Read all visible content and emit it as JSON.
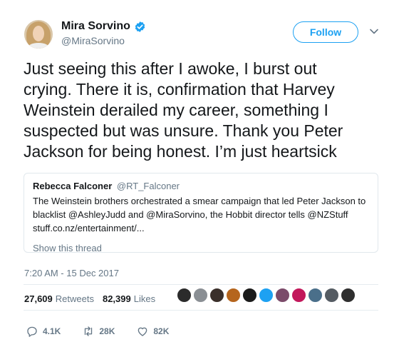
{
  "author": {
    "name": "Mira Sorvino",
    "handle": "@MiraSorvino",
    "verified": true,
    "avatar_icon": "user-avatar"
  },
  "follow_label": "Follow",
  "tweet_text": "Just seeing this after I awoke, I burst out\ncrying. There it is, confirmation that Harvey\nWeinstein derailed my career, something I\nsuspected but was unsure. Thank you Peter\nJackson for being honest. I’m just heartsick",
  "quote": {
    "name": "Rebecca Falconer",
    "handle": "@RT_Falconer",
    "text_line1": "The Weinstein brothers orchestrated a smear campaign that led Peter Jackson to",
    "text_line2": "blacklist @AshleyJudd and @MiraSorvino, the Hobbit director tells @NZStuff",
    "link": "stuff.co.nz/entertainment/...",
    "show_thread": "Show this thread"
  },
  "timestamp": "7:20 AM - 15 Dec 2017",
  "stats": {
    "retweets_count": "27,609",
    "retweets_label": "Retweets",
    "likes_count": "82,399",
    "likes_label": "Likes"
  },
  "liker_colors": [
    "#2b2b2b",
    "#8a8f94",
    "#3a2f2a",
    "#b5651d",
    "#1b1b1b",
    "#1da1f2",
    "#7b4b6a",
    "#c2185b",
    "#4a6f8a",
    "#555c63",
    "#2f2f2f"
  ],
  "actions": {
    "reply_count": "4.1K",
    "retweet_count": "28K",
    "like_count": "82K"
  },
  "colors": {
    "accent": "#1da1f2",
    "secondary_text": "#657786",
    "border": "#e1e8ed"
  }
}
